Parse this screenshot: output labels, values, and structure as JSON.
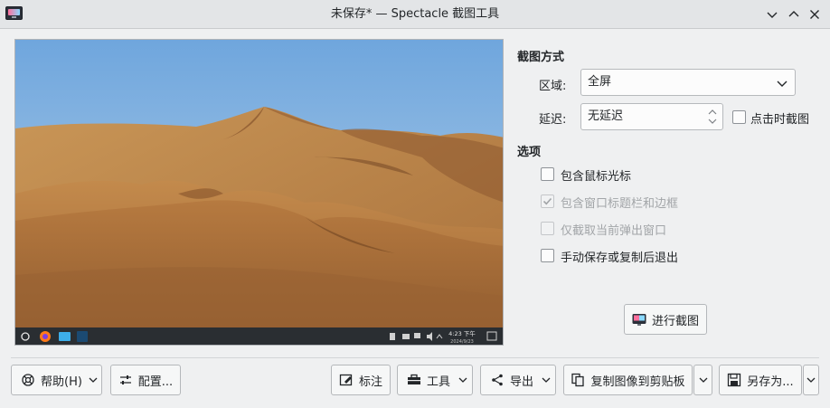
{
  "window": {
    "title": "未保存* — Spectacle 截图工具"
  },
  "preview": {
    "taskbar": {
      "clock_time": "4:23 下午",
      "clock_date": "2024/9/23"
    }
  },
  "capture_mode": {
    "heading": "截图方式",
    "area_label": "区域:",
    "area_value": "全屏",
    "delay_label": "延迟:",
    "delay_value": "无延迟",
    "on_click_label": "点击时截图"
  },
  "options": {
    "heading": "选项",
    "items": [
      {
        "label": "包含鼠标光标",
        "checked": false,
        "enabled": true
      },
      {
        "label": "包含窗口标题栏和边框",
        "checked": true,
        "enabled": false
      },
      {
        "label": "仅截取当前弹出窗口",
        "checked": false,
        "enabled": false
      },
      {
        "label": "手动保存或复制后退出",
        "checked": false,
        "enabled": true
      }
    ]
  },
  "actions": {
    "take_screenshot": "进行截图"
  },
  "bottom_bar": {
    "help": "帮助(H)",
    "configure": "配置...",
    "annotate": "标注",
    "tools": "工具",
    "export": "导出",
    "copy_to_clipboard": "复制图像到剪贴板",
    "save_as": "另存为..."
  },
  "colors": {
    "window_bg": "#eff0f1",
    "titlebar_bg": "#e3e5e7",
    "sky": "#86b5e0",
    "sand": "#c48b4a"
  }
}
